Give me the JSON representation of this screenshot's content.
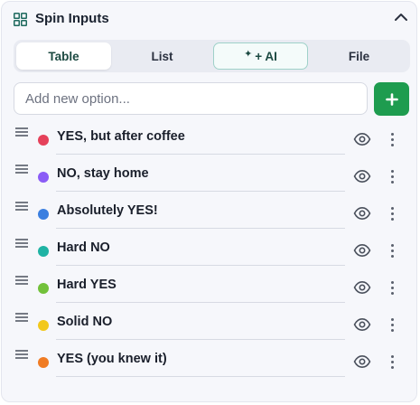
{
  "header": {
    "title": "Spin Inputs",
    "icon": "grid-icon",
    "collapse_icon": "chevron-up-icon"
  },
  "tabs": [
    {
      "label": "Table",
      "active": true
    },
    {
      "label": "List",
      "active": false
    },
    {
      "label": "+ AI",
      "active": false,
      "icon": "sparkles-icon"
    },
    {
      "label": "File",
      "active": false
    }
  ],
  "add": {
    "placeholder": "Add new option...",
    "value": "",
    "button_icon": "plus-icon",
    "button_color": "#1e9c4f"
  },
  "options": [
    {
      "label": "YES, but after coffee",
      "color": "#e5415a"
    },
    {
      "label": "NO, stay home",
      "color": "#8b5cf6"
    },
    {
      "label": "Absolutely YES!",
      "color": "#3b7fe0"
    },
    {
      "label": "Hard NO",
      "color": "#1fb3a4"
    },
    {
      "label": "Hard YES",
      "color": "#72c13a"
    },
    {
      "label": "Solid NO",
      "color": "#f2c81b"
    },
    {
      "label": "YES (you knew it)",
      "color": "#f07c24"
    }
  ]
}
